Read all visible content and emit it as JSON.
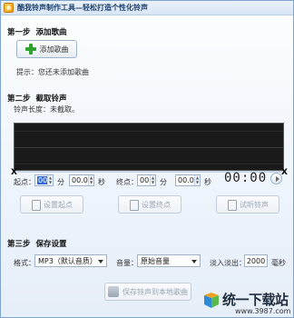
{
  "window": {
    "title": "酷我铃声制作工具—轻松打造个性化铃声"
  },
  "step1": {
    "step": "第一步",
    "title": "添加歌曲",
    "add_button": "添加歌曲",
    "hint": "提示：您还未添加歌曲"
  },
  "step2": {
    "step": "第二步",
    "title": "截取铃声",
    "length_label": "铃声长度：未截取。",
    "start_label": "起点：",
    "start_min": "00",
    "min_unit": "分",
    "start_sec": "00.0",
    "sec_unit": "秒",
    "end_label": "终点：",
    "end_min": "00",
    "end_sec": "00.0",
    "clock": "00:00",
    "marker_left": "X",
    "marker_right": "X",
    "set_start_button": "设置起点",
    "set_end_button": "设置终点",
    "preview_button": "试听铃声"
  },
  "step3": {
    "step": "第三步",
    "title": "保存设置",
    "format_label": "格式：",
    "format_value": "MP3（默认音质）",
    "volume_label": "音量：",
    "volume_value": "原始音量",
    "fade_label": "淡入淡出：",
    "fade_value": "2000",
    "fade_unit": "毫秒",
    "save_button": "保存铃声到本地歌曲"
  },
  "watermark": {
    "brand": "统一下载站",
    "url": "www.3987.com"
  }
}
